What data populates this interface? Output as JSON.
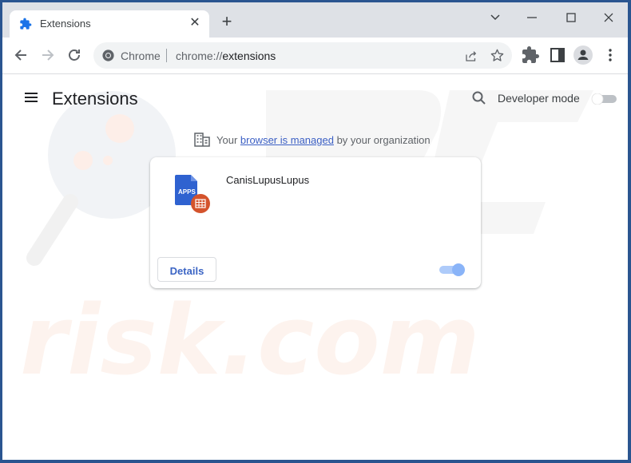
{
  "browser": {
    "tab": {
      "title": "Extensions",
      "icon": "puzzle-icon"
    },
    "new_tab_symbol": "+",
    "window_controls": {
      "menu": "chevron-down-icon",
      "minimize": "minimize-icon",
      "maximize": "maximize-icon",
      "close": "close-icon"
    },
    "omnibox": {
      "site_label": "Chrome",
      "url_prefix": "chrome://",
      "url_path": "extensions"
    }
  },
  "page": {
    "title": "Extensions",
    "developer_mode": {
      "label": "Developer mode",
      "enabled": false
    },
    "managed_notice": {
      "prefix": "Your ",
      "link": "browser is managed",
      "suffix": " by your organization"
    },
    "extensions": [
      {
        "name": "CanisLupusLupus",
        "icon_label": "APPS",
        "details_label": "Details",
        "enabled": true
      }
    ]
  },
  "colors": {
    "accent": "#1a73e8",
    "frame": "#2a5590",
    "toggle_on": "#8ab4f8"
  }
}
